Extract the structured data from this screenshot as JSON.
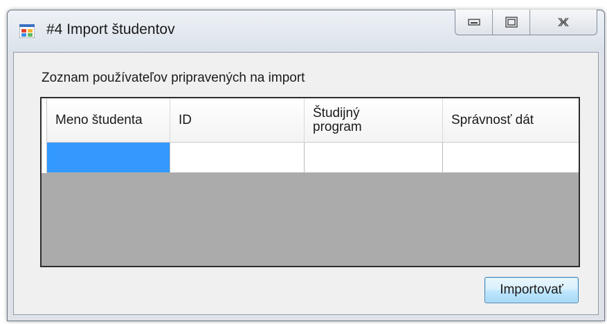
{
  "window": {
    "title": "#4 Import študentov",
    "icon": "windows-form-icon"
  },
  "caption_buttons": {
    "minimize_icon": "minimize-icon",
    "maximize_icon": "maximize-icon",
    "close_icon": "close-icon"
  },
  "section": {
    "label": "Zoznam používateľov pripravených na import"
  },
  "table": {
    "columns": [
      {
        "label": "Meno študenta"
      },
      {
        "label": "ID"
      },
      {
        "label": "Študijný program"
      },
      {
        "label": "Správnosť dát"
      }
    ],
    "rows": [
      [
        "",
        "",
        "",
        ""
      ]
    ],
    "selected_cell_color": "#3399ff",
    "empty_area_color": "#ababab"
  },
  "actions": {
    "import_label": "Importovať"
  }
}
